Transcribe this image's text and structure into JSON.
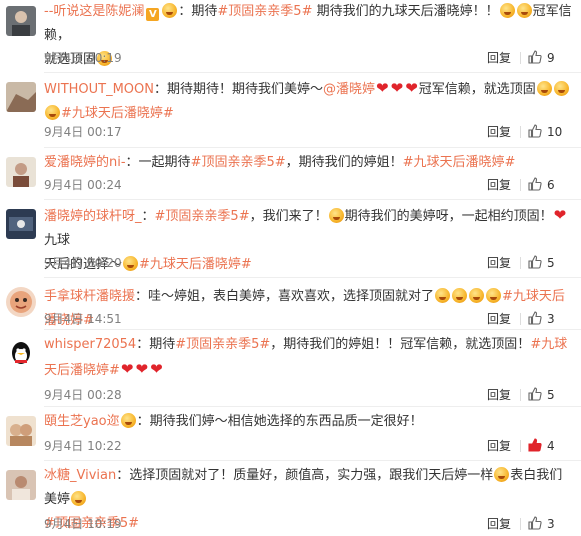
{
  "comments": [
    {
      "user": "--听说这是陈妮澜",
      "text_1": "：期待",
      "topic_1": "#顶固亲亲季5#",
      "text_2": " 期待我们的九球天后潘晓婷！！",
      "text_3": "冠军信赖，",
      "text_4": "就选顶固",
      "time": "9月4日 00:19",
      "reply": "回复",
      "likes": "9"
    },
    {
      "user": "WITHOUT_MOON",
      "text_1": "：期待期待！期待我们美婷～",
      "mention": "@潘晓婷",
      "text_2": "冠军信赖，就选顶固",
      "topic_1": "#九球天后潘晓婷#",
      "time": "9月4日 00:17",
      "reply": "回复",
      "likes": "10"
    },
    {
      "user": "爱潘晓婷的ni-",
      "text_1": "：一起期待",
      "topic_1": "#顶固亲亲季5#",
      "text_2": "，期待我们的婷姐！",
      "topic_2": "#九球天后潘晓婷#",
      "time": "9月4日 00:24",
      "reply": "回复",
      "likes": "6"
    },
    {
      "user": "潘晓婷的球杆呀_",
      "text_1": "：",
      "topic_1": "#顶固亲亲季5#",
      "text_2": "，我们来了！",
      "text_3": "期待我们的美婷呀，一起相约顶固！",
      "text_4": "九球",
      "text_5": "天后的选择～",
      "topic_2": "#九球天后潘晓婷#",
      "time": "9月4日 00:20",
      "reply": "回复",
      "likes": "5"
    },
    {
      "user": "手拿球杆潘晓援",
      "text_1": "：哇～婷姐，表白美婷，喜欢喜欢，选择顶固就对了",
      "topic_1": "#九球天后潘晓婷#",
      "time": "9月4日 14:51",
      "reply": "回复",
      "likes": "3"
    },
    {
      "user": "whisper72054",
      "text_1": "：期待",
      "topic_1": "#顶固亲亲季5#",
      "text_2": "，期待我们的婷姐！！冠军信赖，就选顶固！",
      "topic_2": "#九球天后潘晓婷#",
      "time": "9月4日 00:28",
      "reply": "回复",
      "likes": "5"
    },
    {
      "user": "頤生芝yao迩",
      "text_1": "：期待我们婷～相信她选择的东西品质一定很好！",
      "time": "9月4日 10:22",
      "reply": "回复",
      "likes": "4"
    },
    {
      "user": "冰糖_Vivian",
      "text_1": "：选择顶固就对了！质量好，颜值高，实力强，跟我们天后婷一样",
      "text_2": "表白我们美婷",
      "topic_1": "#顶固亲亲季5#",
      "time": "9月4日 10:19",
      "reply": "回复",
      "likes": "3"
    }
  ],
  "colors": {
    "link": "#eb7350",
    "heart": "#e0242b",
    "like_active": "#e0242b"
  },
  "icons": [
    "thumbs-up-icon",
    "smiley-emoji-icon",
    "heart-icon",
    "crown-icon"
  ]
}
